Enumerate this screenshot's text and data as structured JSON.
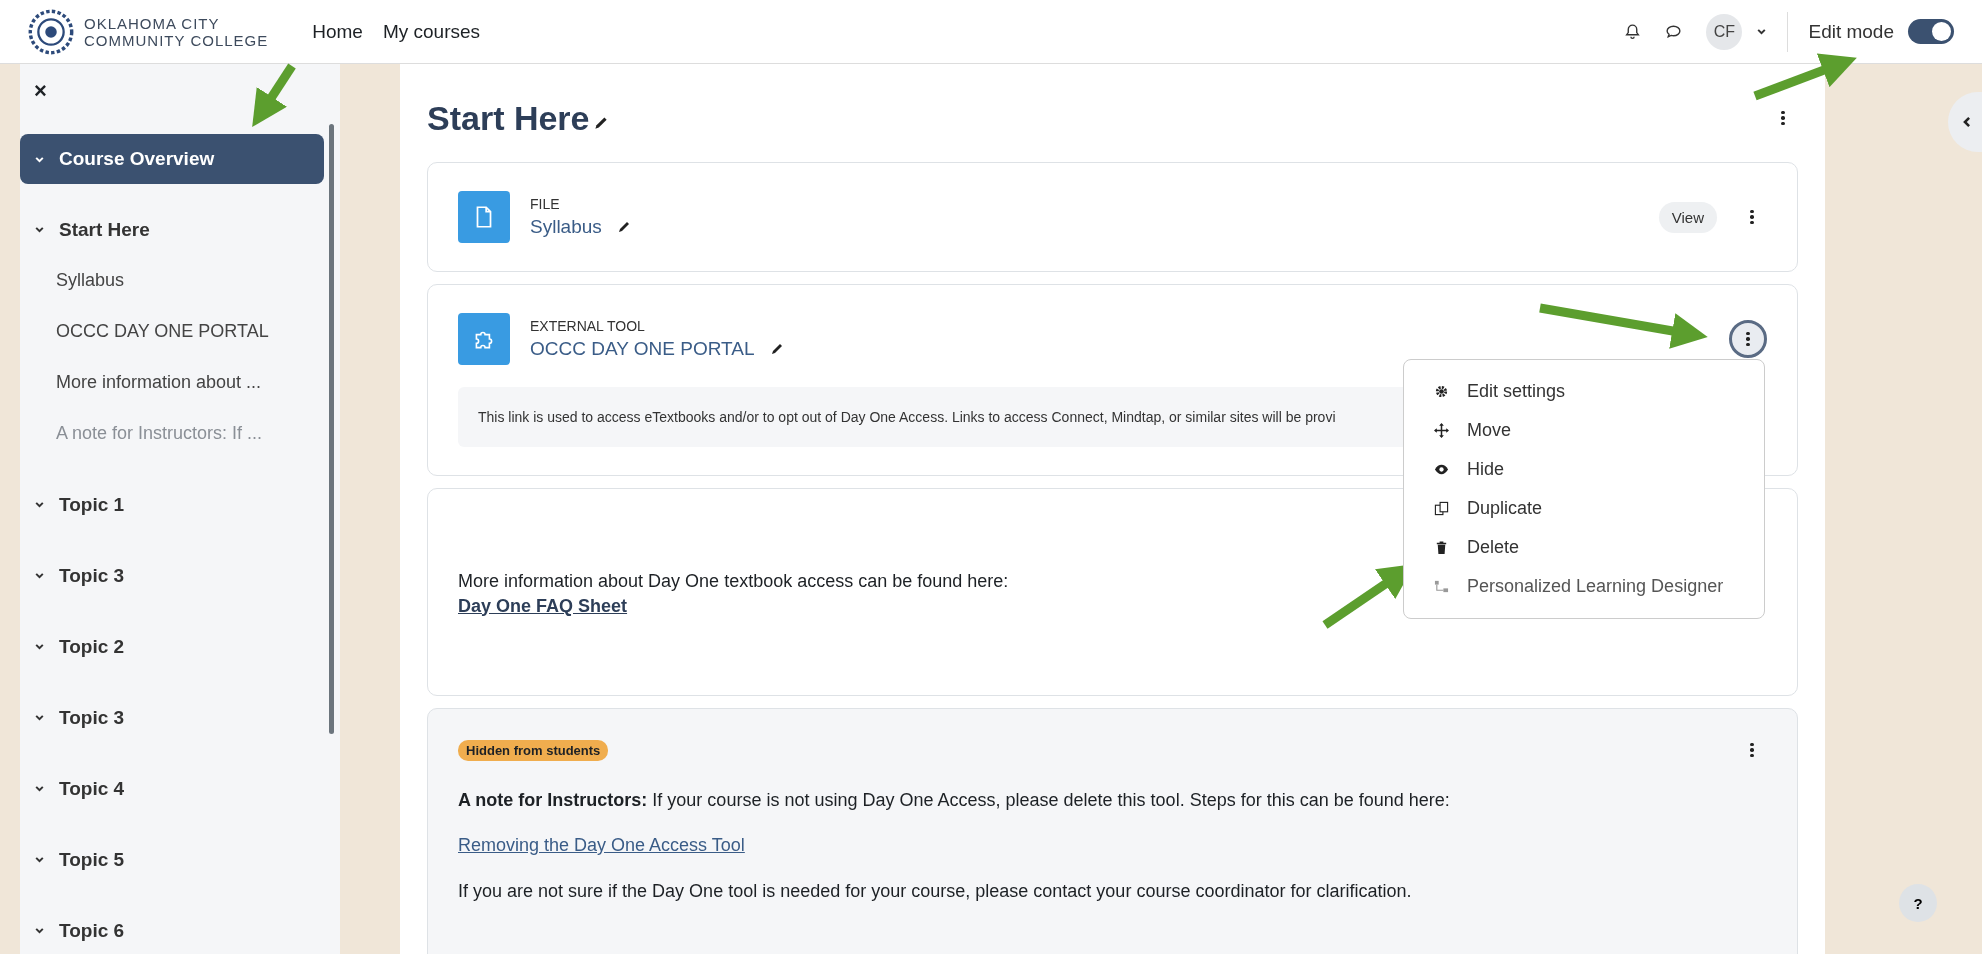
{
  "header": {
    "logo_line1": "OKLAHOMA CITY",
    "logo_line2": "COMMUNITY COLLEGE",
    "nav": [
      {
        "label": "Home"
      },
      {
        "label": "My courses"
      }
    ],
    "avatar": "CF",
    "edit_mode": {
      "label": "Edit mode",
      "on": true
    }
  },
  "sidebar": {
    "close": "×",
    "overview": {
      "label": "Course Overview",
      "selected": true
    },
    "sections": [
      {
        "label": "Start Here",
        "expanded": true,
        "children": [
          {
            "label": "Syllabus",
            "hidden": false
          },
          {
            "label": "OCCC DAY ONE PORTAL",
            "hidden": false
          },
          {
            "label": "More information about ...",
            "hidden": false
          },
          {
            "label": "A note for Instructors: If ...",
            "hidden": true
          }
        ]
      },
      {
        "label": "Topic 1",
        "expanded": true
      },
      {
        "label": "Topic 3",
        "expanded": true
      },
      {
        "label": "Topic 2",
        "expanded": true
      },
      {
        "label": "Topic 3",
        "expanded": true
      },
      {
        "label": "Topic 4",
        "expanded": true
      },
      {
        "label": "Topic 5",
        "expanded": true
      },
      {
        "label": "Topic 6",
        "expanded": true
      }
    ]
  },
  "section_title": "Start Here",
  "activities": [
    {
      "kind": "file",
      "type": "FILE",
      "name": "Syllabus",
      "view": "View",
      "menu_open": false
    },
    {
      "kind": "external_tool",
      "type": "EXTERNAL TOOL",
      "name": "OCCC DAY ONE PORTAL",
      "description": "This link is used to access eTextbooks and/or to opt out of Day One Access. Links to access Connect, Mindtap, or similar sites will be provi",
      "menu_open": true
    }
  ],
  "action_menu": [
    {
      "label": "Edit settings"
    },
    {
      "label": "Move"
    },
    {
      "label": "Hide"
    },
    {
      "label": "Duplicate"
    },
    {
      "label": "Delete"
    },
    {
      "label": "Personalized Learning Designer",
      "disabled": true
    }
  ],
  "text_block": {
    "text": "More information about Day One textbook access can be found here:",
    "link": "Day One FAQ Sheet"
  },
  "note_block": {
    "badge": "Hidden from students",
    "intro": "**A note for Instructors:** If your course is not using Day One Access, please delete this tool. Steps for this can be found here:",
    "link": "Removing the Day One Access Tool",
    "outro": "If you are not sure if the Day One tool is needed for your course, please contact your course coordinator for clarification."
  },
  "help": "?"
}
